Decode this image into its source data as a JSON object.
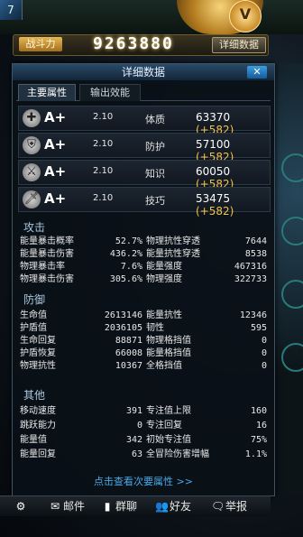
{
  "header": {
    "top_icon": "7",
    "rank_letter": "V"
  },
  "power": {
    "label": "战斗力",
    "value": "9263880",
    "detail_button": "详细数据"
  },
  "panel": {
    "title": "详细数据",
    "close_icon": "close-icon",
    "tabs": [
      {
        "label": "主要属性",
        "active": true
      },
      {
        "label": "输出效能",
        "active": false
      }
    ],
    "attributes": [
      {
        "icon": "plus-icon",
        "glyph": "✚",
        "grade": "A+",
        "multiplier": "2.10",
        "name": "体质",
        "value": "63370",
        "bonus": "(+582)"
      },
      {
        "icon": "shield-icon",
        "glyph": "⛨",
        "grade": "A+",
        "multiplier": "2.10",
        "name": "防护",
        "value": "57100",
        "bonus": "(+582)"
      },
      {
        "icon": "staff-icon",
        "glyph": "⚔",
        "grade": "A+",
        "multiplier": "2.10",
        "name": "知识",
        "value": "60050",
        "bonus": "(+582)"
      },
      {
        "icon": "sword-icon",
        "glyph": "🗡",
        "grade": "A+",
        "multiplier": "2.10",
        "name": "技巧",
        "value": "53475",
        "bonus": "(+582)"
      }
    ],
    "sections": {
      "attack": {
        "title": "攻击",
        "left": [
          {
            "name": "能量暴击概率",
            "value": "52.7%"
          },
          {
            "name": "能量暴击伤害",
            "value": "436.2%"
          },
          {
            "name": "物理暴击率",
            "value": "7.6%"
          },
          {
            "name": "物理暴击伤害",
            "value": "305.6%"
          }
        ],
        "right": [
          {
            "name": "物理抗性穿透",
            "value": "7644"
          },
          {
            "name": "能量抗性穿透",
            "value": "8538"
          },
          {
            "name": "能量强度",
            "value": "467316"
          },
          {
            "name": "物理强度",
            "value": "322733"
          }
        ]
      },
      "defense": {
        "title": "防御",
        "left": [
          {
            "name": "生命值",
            "value": "2613146"
          },
          {
            "name": "护盾值",
            "value": "2036105"
          },
          {
            "name": "生命回复",
            "value": "88871"
          },
          {
            "name": "护盾恢复",
            "value": "66008"
          },
          {
            "name": "物理抗性",
            "value": "10367"
          }
        ],
        "right": [
          {
            "name": "能量抗性",
            "value": "12346"
          },
          {
            "name": "韧性",
            "value": "595"
          },
          {
            "name": "物理格挡值",
            "value": "0"
          },
          {
            "name": "能量格挡值",
            "value": "0"
          },
          {
            "name": "全格挡值",
            "value": "0"
          }
        ]
      },
      "other": {
        "title": "其他",
        "left": [
          {
            "name": "移动速度",
            "value": "391"
          },
          {
            "name": "跳跃能力",
            "value": "0"
          },
          {
            "name": "能量值",
            "value": "342"
          },
          {
            "name": "能量回复",
            "value": "63"
          }
        ],
        "right": [
          {
            "name": "专注值上限",
            "value": "160"
          },
          {
            "name": "专注回复",
            "value": "16"
          },
          {
            "name": "初始专注值",
            "value": "75%"
          },
          {
            "name": "全冒险伤害增幅",
            "value": "1.1%"
          }
        ]
      }
    },
    "more_link": "点击查看次要属性 >>"
  },
  "bottom_bar": [
    {
      "icon": "gear-icon",
      "glyph": "⚙",
      "label": ""
    },
    {
      "icon": "mail-icon",
      "glyph": "✉",
      "label": "邮件"
    },
    {
      "icon": "chat-icon",
      "glyph": "▮",
      "label": "群聊"
    },
    {
      "icon": "friends-icon",
      "glyph": "👥",
      "label": "好友"
    },
    {
      "icon": "report-icon",
      "glyph": "🗨",
      "label": "举报"
    }
  ]
}
